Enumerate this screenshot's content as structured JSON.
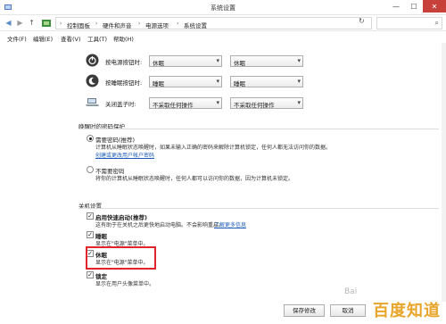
{
  "window": {
    "title": "系统设置",
    "minimize": "—",
    "maximize": "☐",
    "close": "✕"
  },
  "addressbar": {
    "back": "◀",
    "forward": "▶",
    "up": "↑",
    "sep": "›",
    "crumbs": [
      "控制面板",
      "硬件和声音",
      "电源选项",
      "系统设置"
    ],
    "refresh": "↻",
    "search_icon": "⌕"
  },
  "menu": {
    "items": [
      "文件(F)",
      "编辑(E)",
      "查看(V)",
      "工具(T)",
      "帮助(H)"
    ]
  },
  "power_buttons": {
    "rows": [
      {
        "label": "按电源按钮时:",
        "icon": "power-button-icon",
        "battery": "休眠",
        "plugged": "休眠"
      },
      {
        "label": "按睡眠按钮时:",
        "icon": "sleep-button-icon",
        "battery": "睡眠",
        "plugged": "睡眠"
      },
      {
        "label": "关闭盖子时:",
        "icon": "laptop-lid-icon",
        "battery": "不采取任何操作",
        "plugged": "不采取任何操作"
      }
    ],
    "chevron": "▾"
  },
  "password_protection": {
    "title": "唤醒时的密码保护",
    "require": {
      "label": "需要密码(推荐)",
      "desc1": "计算机从睡眠状态唤醒时，如果未输入正确的密码来解除计算机锁定，任何人都无法访问你的数据。",
      "desc2": "此",
      "link": "创建或更改用户帐户密码",
      "selected": true
    },
    "not_require": {
      "label": "不需要密码",
      "desc": "将你的计算机从睡眠状态唤醒时，任何人都可以访问你的数据，因为计算机未锁定。",
      "selected": false
    }
  },
  "shutdown_settings": {
    "title": "关机设置",
    "items": [
      {
        "label": "启用快速启动(推荐)",
        "desc": "这有助于在关机之后更快地启动电脑。不会影响重启。",
        "link": "了解更多信息",
        "checked": true
      },
      {
        "label": "睡眠",
        "desc": "显示在\"电源\"菜单中。",
        "checked": true
      },
      {
        "label": "休眠",
        "desc": "显示在\"电源\"菜单中。",
        "checked": true
      },
      {
        "label": "锁定",
        "desc": "显示在用户头像菜单中。",
        "checked": true
      }
    ],
    "check_mark": "✓"
  },
  "footer": {
    "save": "保存修改",
    "cancel": "取消"
  },
  "watermark": {
    "text": "百度知道",
    "small": "Bai"
  },
  "colors": {
    "highlight_border": "#e0262c",
    "link": "#1e5bb6",
    "close_button": "#c7403a",
    "watermark": "#e8a52a"
  }
}
